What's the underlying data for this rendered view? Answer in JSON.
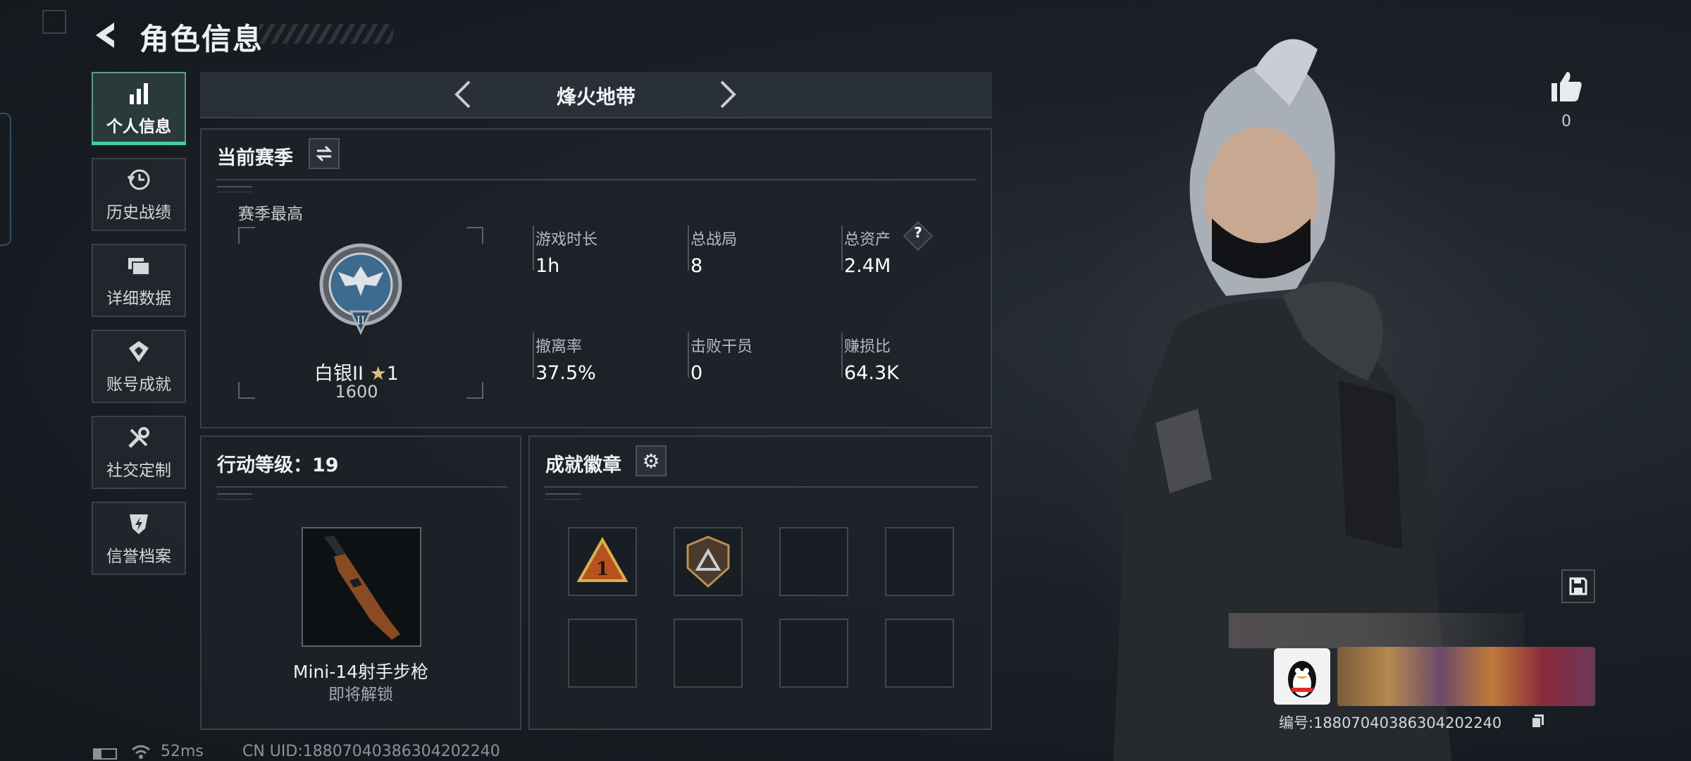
{
  "header": {
    "title": "角色信息"
  },
  "nav": {
    "items": [
      {
        "label": "个人信息"
      },
      {
        "label": "历史战绩"
      },
      {
        "label": "详细数据"
      },
      {
        "label": "账号成就"
      },
      {
        "label": "社交定制"
      },
      {
        "label": "信誉档案"
      }
    ],
    "active_index": 0
  },
  "mode": {
    "title": "烽火地带"
  },
  "season": {
    "title": "当前赛季",
    "best_label": "赛季最高",
    "rank_name": "白银II",
    "rank_stars": "1",
    "rank_points": "1600",
    "rank_insignia_numeral": "II",
    "stats": [
      {
        "label": "游戏时长",
        "value": "1h"
      },
      {
        "label": "总战局",
        "value": "8"
      },
      {
        "label": "总资产",
        "value": "2.4M",
        "help": "?"
      },
      {
        "label": "撤离率",
        "value": "37.5%"
      },
      {
        "label": "击败干员",
        "value": "0"
      },
      {
        "label": "赚损比",
        "value": "64.3K"
      }
    ]
  },
  "action_level": {
    "title": "行动等级：19",
    "weapon_name": "Mini-14射手步枪",
    "weapon_status": "即将解锁"
  },
  "achievements": {
    "title": "成就徽章",
    "badges": [
      {
        "icon": "rank-1-triangle-badge",
        "numeral": "1"
      },
      {
        "icon": "shield-triangle-badge"
      },
      {
        "icon": ""
      },
      {
        "icon": ""
      },
      {
        "icon": ""
      },
      {
        "icon": ""
      },
      {
        "icon": ""
      },
      {
        "icon": ""
      }
    ]
  },
  "character": {
    "likes": "0",
    "id_text": "编号:18807040386304202240"
  },
  "status_bar": {
    "ping": "52ms",
    "uid": "CN UID:18807040386304202240"
  },
  "colors": {
    "accent": "#3fd0a0",
    "panel_border": "#394047",
    "background": "#1b2027",
    "star": "#d9c27a"
  }
}
